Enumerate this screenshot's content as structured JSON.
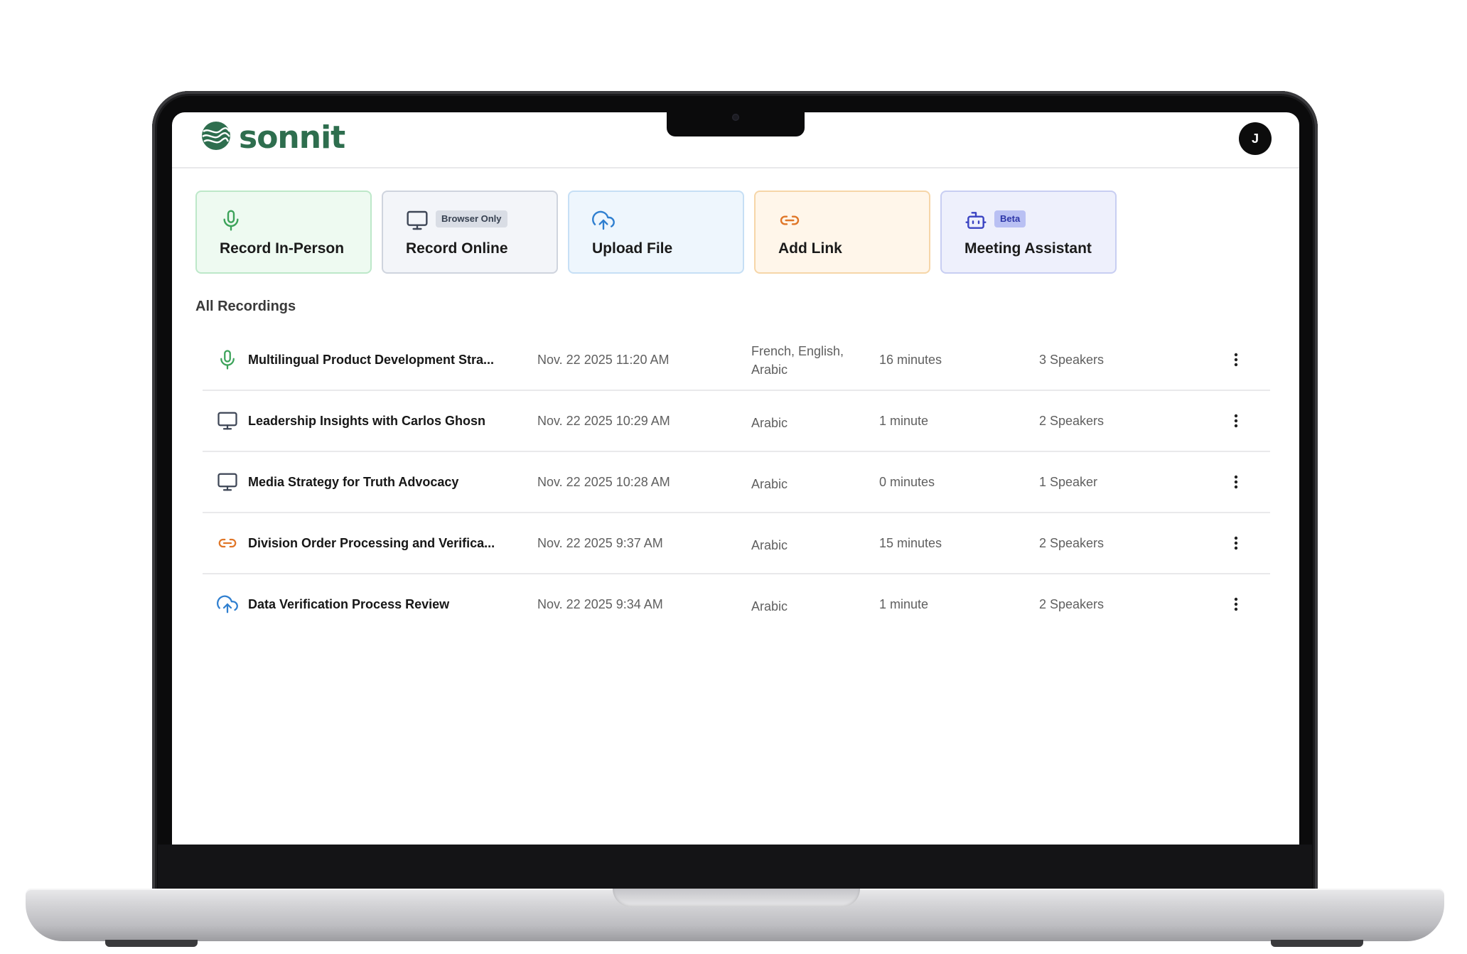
{
  "app": {
    "name": "sonnit",
    "brand_color": "#2e6e4e"
  },
  "header": {
    "avatar_initial": "J"
  },
  "actions": [
    {
      "label": "Record In-Person",
      "icon": "microphone-icon",
      "color": "#3ca35a"
    },
    {
      "label": "Record Online",
      "icon": "monitor-icon",
      "tag": "Browser Only",
      "color": "#3e4656"
    },
    {
      "label": "Upload File",
      "icon": "cloud-upload-icon",
      "color": "#2f7fd0"
    },
    {
      "label": "Add Link",
      "icon": "link-icon",
      "color": "#e07628"
    },
    {
      "label": "Meeting Assistant",
      "icon": "bot-icon",
      "tag": "Beta",
      "color": "#3a43c2"
    }
  ],
  "recordings": {
    "title": "All Recordings",
    "rows": [
      {
        "icon": "microphone-icon",
        "title": "Multilingual Product Development Stra...",
        "date": "Nov. 22 2025 11:20 AM",
        "languages": "French, English, Arabic",
        "duration": "16 minutes",
        "speakers": "3 Speakers"
      },
      {
        "icon": "monitor-icon",
        "title": "Leadership Insights with Carlos Ghosn",
        "date": "Nov. 22 2025 10:29 AM",
        "languages": "Arabic",
        "duration": "1 minute",
        "speakers": "2 Speakers"
      },
      {
        "icon": "monitor-icon",
        "title": "Media Strategy for Truth Advocacy",
        "date": "Nov. 22 2025 10:28 AM",
        "languages": "Arabic",
        "duration": "0 minutes",
        "speakers": "1 Speaker"
      },
      {
        "icon": "link-icon",
        "title": "Division Order Processing and Verifica...",
        "date": "Nov. 22 2025 9:37 AM",
        "languages": "Arabic",
        "duration": "15 minutes",
        "speakers": "2 Speakers"
      },
      {
        "icon": "cloud-upload-icon",
        "title": "Data Verification Process Review",
        "date": "Nov. 22 2025 9:34 AM",
        "languages": "Arabic",
        "duration": "1 minute",
        "speakers": "2 Speakers"
      }
    ]
  }
}
